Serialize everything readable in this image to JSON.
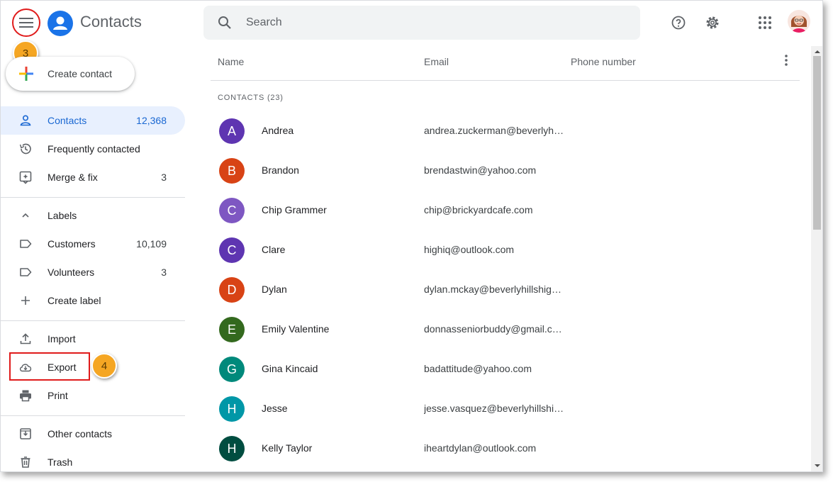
{
  "app": {
    "title": "Contacts"
  },
  "search": {
    "placeholder": "Search"
  },
  "callouts": {
    "menu_step": "3",
    "export_step": "4"
  },
  "sidebar": {
    "create_label": "Create contact",
    "items": [
      {
        "label": "Contacts",
        "count": "12,368",
        "icon": "person-icon"
      },
      {
        "label": "Frequently contacted",
        "count": "",
        "icon": "history-icon"
      },
      {
        "label": "Merge & fix",
        "count": "3",
        "icon": "merge-icon"
      },
      {
        "label": "Labels",
        "count": "",
        "icon": "chevron-up-icon"
      },
      {
        "label": "Customers",
        "count": "10,109",
        "icon": "label-icon"
      },
      {
        "label": "Volunteers",
        "count": "3",
        "icon": "label-icon"
      },
      {
        "label": "Create label",
        "count": "",
        "icon": "plus-icon"
      },
      {
        "label": "Import",
        "count": "",
        "icon": "upload-icon"
      },
      {
        "label": "Export",
        "count": "",
        "icon": "cloud-download-icon"
      },
      {
        "label": "Print",
        "count": "",
        "icon": "print-icon"
      },
      {
        "label": "Other contacts",
        "count": "",
        "icon": "archive-icon"
      },
      {
        "label": "Trash",
        "count": "",
        "icon": "trash-icon"
      }
    ]
  },
  "table": {
    "headers": {
      "name": "Name",
      "email": "Email",
      "phone": "Phone number"
    },
    "section_label": "CONTACTS (23)",
    "rows": [
      {
        "initial": "A",
        "name": "Andrea",
        "email": "andrea.zuckerman@beverlyhi…",
        "color": "#5e35b1"
      },
      {
        "initial": "B",
        "name": "Brandon",
        "email": "brendastwin@yahoo.com",
        "color": "#d84315"
      },
      {
        "initial": "C",
        "name": "Chip Grammer",
        "email": "chip@brickyardcafe.com",
        "color": "#7e57c2"
      },
      {
        "initial": "C",
        "name": "Clare",
        "email": "highiq@outlook.com",
        "color": "#5e35b1"
      },
      {
        "initial": "D",
        "name": "Dylan",
        "email": "dylan.mckay@beverlyhillshig…",
        "color": "#d84315"
      },
      {
        "initial": "E",
        "name": "Emily Valentine",
        "email": "donnasseniorbuddy@gmail.c…",
        "color": "#33691e"
      },
      {
        "initial": "G",
        "name": "Gina Kincaid",
        "email": "badattitude@yahoo.com",
        "color": "#00897b"
      },
      {
        "initial": "H",
        "name": "Jesse",
        "email": "jesse.vasquez@beverlyhillshi…",
        "color": "#0097a7"
      },
      {
        "initial": "H",
        "name": "Kelly Taylor",
        "email": "iheartdylan@outlook.com",
        "color": "#004d40"
      }
    ]
  },
  "colors": {
    "accent": "#1a73e8",
    "active_bg": "#e8f0fe",
    "callout": "#f5a623",
    "highlight": "#e01b1b"
  }
}
